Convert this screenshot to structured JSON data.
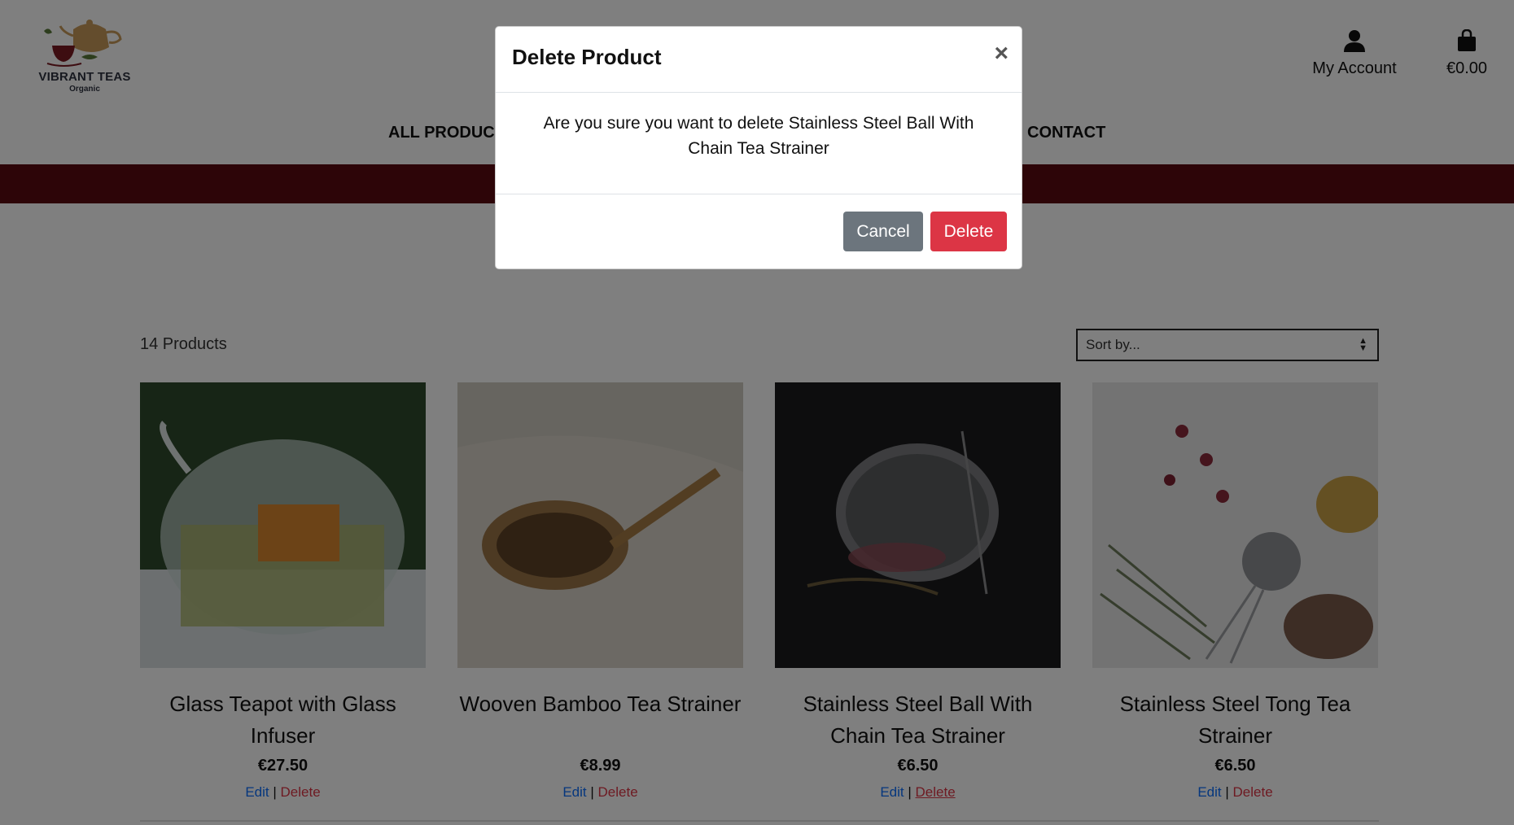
{
  "brand": {
    "name": "VIBRANT TEAS",
    "tagline": "Organic"
  },
  "header": {
    "account_label": "My Account",
    "bag_total": "€0.00"
  },
  "nav": {
    "items": [
      "ALL PRODUCTS",
      "CONTACT"
    ]
  },
  "products": {
    "count_label": "14 Products",
    "sort_placeholder": "Sort by...",
    "items": [
      {
        "title": "Glass Teapot with Glass Infuser",
        "price": "€27.50",
        "edit": "Edit",
        "sep": "|",
        "delete": "Delete"
      },
      {
        "title": "Wooven Bamboo Tea Strainer",
        "price": "€8.99",
        "edit": "Edit",
        "sep": "|",
        "delete": "Delete"
      },
      {
        "title": "Stainless Steel Ball With Chain Tea Strainer",
        "price": "€6.50",
        "edit": "Edit",
        "sep": "|",
        "delete": "Delete"
      },
      {
        "title": "Stainless Steel Tong Tea Strainer",
        "price": "€6.50",
        "edit": "Edit",
        "sep": "|",
        "delete": "Delete"
      }
    ]
  },
  "modal": {
    "title": "Delete Product",
    "close": "×",
    "message": "Are you sure you want to delete Stainless Steel Ball With Chain Tea Strainer",
    "cancel": "Cancel",
    "confirm": "Delete"
  },
  "colors": {
    "banner": "#5a0b11",
    "danger": "#dc3545",
    "secondary": "#6c757d",
    "link": "#0d6efd"
  },
  "icons": [
    "teapot-logo-icon",
    "user-icon",
    "shopping-bag-icon",
    "sort-arrows-icon",
    "close-icon"
  ]
}
